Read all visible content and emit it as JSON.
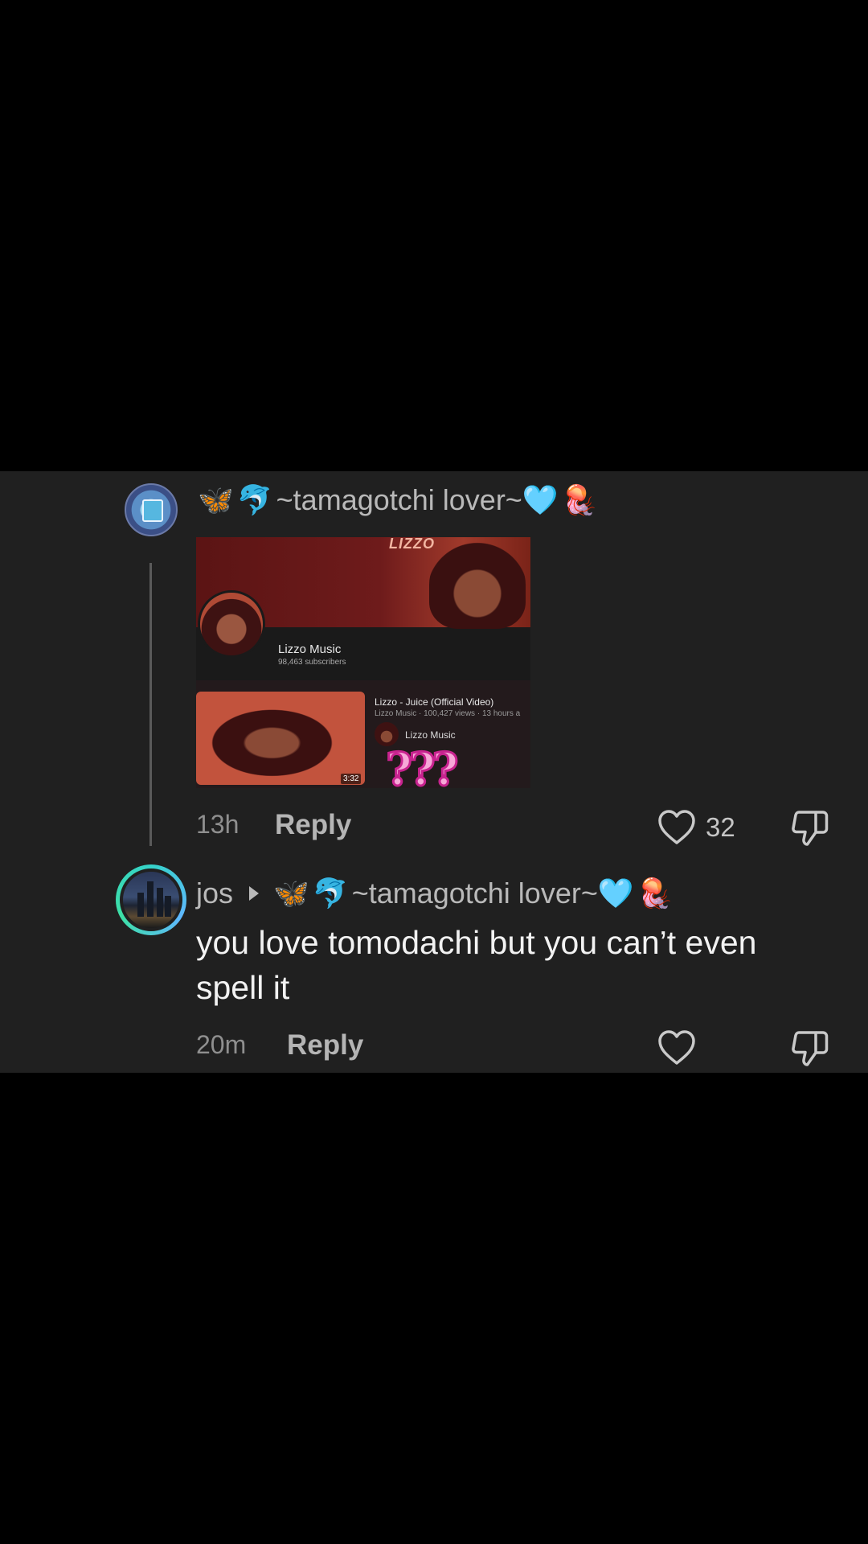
{
  "comments": [
    {
      "username": "~tamagotchi lover~",
      "username_emoji_prefix": [
        "🦋",
        "🐬"
      ],
      "username_emoji_suffix": [
        "🩵",
        "🪼"
      ],
      "attachment": {
        "channel_name": "Lizzo Music",
        "subscribers": "98,463 subscribers",
        "banner_word": "LIZZO",
        "video_title": "Lizzo - Juice (Official Video)",
        "video_meta": "Lizzo Music · 100,427 views · 13 hours a",
        "video_channel": "Lizzo Music",
        "duration": "3:32",
        "overlay_text": "???"
      },
      "time": "13h",
      "reply_label": "Reply",
      "like_count": "32",
      "icons": {
        "like": "heart-icon",
        "dislike": "thumbs-down-icon"
      }
    },
    {
      "username": "jos",
      "reply_to": "~tamagotchi lover~",
      "reply_to_emoji_prefix": [
        "🦋",
        "🐬"
      ],
      "reply_to_emoji_suffix": [
        "🩵",
        "🪼"
      ],
      "text": "you love tomodachi but you can’t even spell it",
      "time": "20m",
      "reply_label": "Reply",
      "icons": {
        "like": "heart-icon",
        "dislike": "thumbs-down-icon",
        "reply_arrow": "caret-right-icon"
      }
    }
  ]
}
